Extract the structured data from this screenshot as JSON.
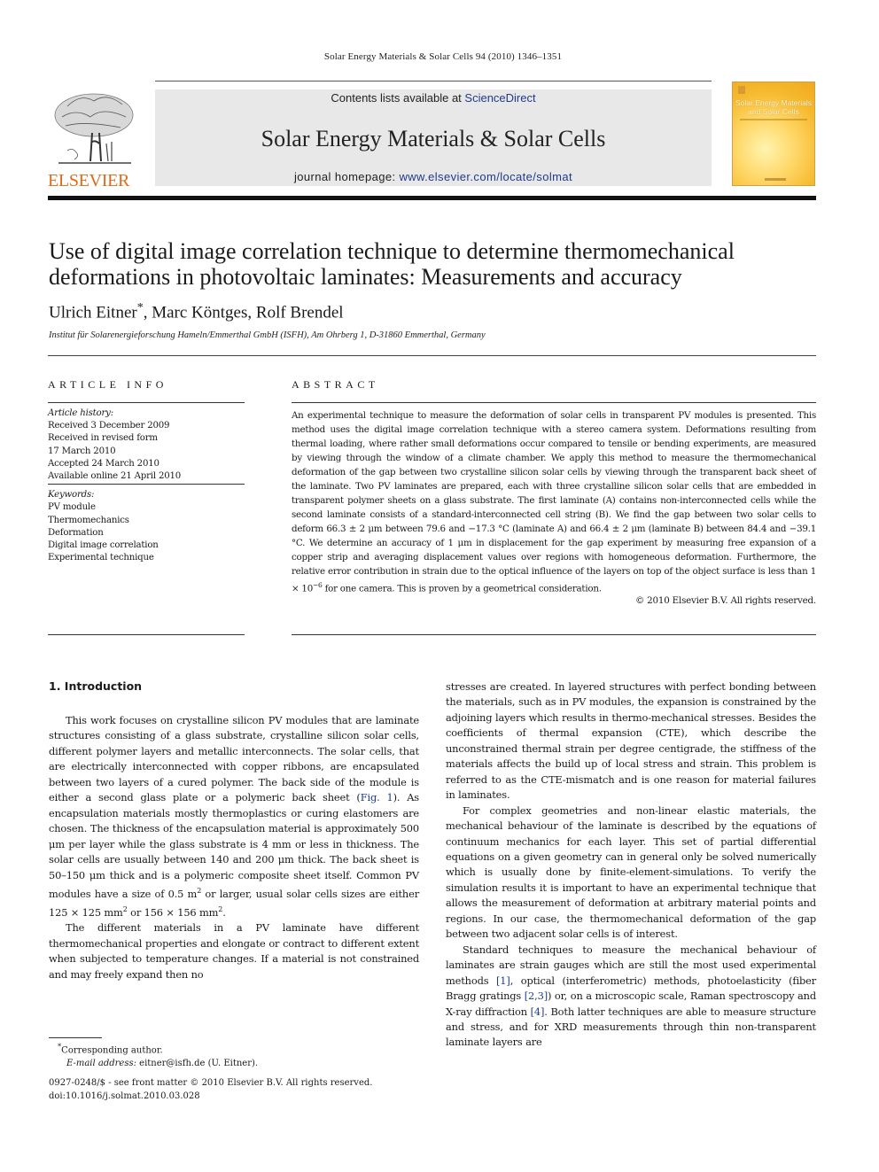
{
  "running_head": "Solar Energy Materials & Solar Cells 94 (2010) 1346–1351",
  "header": {
    "publisher_logo": "ELSEVIER",
    "contents_prefix": "Contents lists available at ",
    "contents_link": "ScienceDirect",
    "journal_name": "Solar Energy Materials & Solar Cells",
    "homepage_prefix": "journal homepage: ",
    "homepage_link": "www.elsevier.com/locate/solmat",
    "cover_title": "Solar Energy Materials and Solar Cells",
    "colors": {
      "publisher_orange": "#e06a1a",
      "link_blue": "#1f3b8c",
      "banner_gray": "#e8e8e8"
    }
  },
  "article": {
    "title": "Use of digital image correlation technique to determine thermomechanical deformations in photovoltaic laminates: Measurements and accuracy",
    "authors": [
      {
        "name": "Ulrich Eitner",
        "mark": "*"
      },
      {
        "name": "Marc Köntges",
        "mark": ""
      },
      {
        "name": "Rolf Brendel",
        "mark": ""
      }
    ],
    "affiliation": "Institut für Solarenergieforschung Hameln/Emmerthal GmbH (ISFH), Am Ohrberg 1, D-31860 Emmerthal, Germany"
  },
  "article_info": {
    "heading": "ARTICLE INFO",
    "history_label": "Article history:",
    "history": [
      "Received 3 December 2009",
      "Received in revised form",
      "17 March 2010",
      "Accepted 24 March 2010",
      "Available online 21 April 2010"
    ],
    "keywords_label": "Keywords:",
    "keywords": [
      "PV module",
      "Thermomechanics",
      "Deformation",
      "Digital image correlation",
      "Experimental technique"
    ]
  },
  "abstract": {
    "heading": "ABSTRACT",
    "text_1": "An experimental technique to measure the deformation of solar cells in transparent PV modules is presented. This method uses the digital image correlation technique with a stereo camera system. Deformations resulting from thermal loading, where rather small deformations occur compared to tensile or bending experiments, are measured by viewing through the window of a climate chamber. We apply this method to measure the thermomechanical deformation of the gap between two crystalline silicon solar cells by viewing through the transparent back sheet of the laminate. Two PV laminates are prepared, each with three crystalline silicon solar cells that are embedded in transparent polymer sheets on a glass substrate. The first laminate (A) contains non-interconnected cells while the second laminate consists of a standard-interconnected cell string (B). We find the gap between two solar cells to deform 66.3 ± 2 μm between 79.6 and −17.3 °C (laminate A) and 66.4 ± 2 μm (laminate B) between 84.4 and −39.1 °C. We determine an accuracy of 1 μm in displacement for the gap experiment by measuring free expansion of a copper strip and averaging displacement values over regions with homogeneous deformation. Furthermore, the relative error contribution in strain due to the optical influence of the layers on top of the object surface is less than 1 × 10",
    "exponent": "−6",
    "text_2": " for one camera. This is proven by a geometrical consideration.",
    "copyright": "© 2010 Elsevier B.V. All rights reserved."
  },
  "body": {
    "section_heading": "1.  Introduction",
    "col1": {
      "p1_a": "This work focuses on crystalline silicon PV modules that are laminate structures consisting of a glass substrate, crystalline silicon solar cells, different polymer layers and metallic interconnects. The solar cells, that are electrically interconnected with copper ribbons, are encapsulated between two layers of a cured polymer. The back side of the module is either a second glass plate or a polymeric back sheet (",
      "p1_link": "Fig. 1",
      "p1_b": "). As encapsulation materials mostly thermoplastics or curing elastomers are chosen. The thickness of the encapsulation material is approximately 500 μm per layer while the glass substrate is 4 mm or less in thickness. The solar cells are usually between 140 and 200 μm thick. The back sheet is 50–150 μm thick and is a polymeric composite sheet itself. Common PV modules have a size of 0.5 m",
      "p1_sup1": "2",
      "p1_c": " or larger, usual solar cells sizes are either 125 × 125 mm",
      "p1_sup2": "2",
      "p1_d": " or 156 × 156 mm",
      "p1_sup3": "2",
      "p1_e": ".",
      "p2": "The different materials in a PV laminate have different thermomechanical properties and elongate or contract to different extent when subjected to temperature changes. If a material is not constrained and may freely expand then no"
    },
    "col2": {
      "p1": "stresses are created. In layered structures with perfect bonding between the materials, such as in PV modules, the expansion is constrained by the adjoining layers which results in thermo-mechanical stresses. Besides the coefficients of thermal expansion (CTE), which describe the unconstrained thermal strain per degree centigrade, the stiffness of the materials affects the build up of local stress and strain. This problem is referred to as the CTE-mismatch and is one reason for material failures in laminates.",
      "p2": "For complex geometries and non-linear elastic materials, the mechanical behaviour of the laminate is described by the equations of continuum mechanics for each layer. This set of partial differential equations on a given geometry can in general only be solved numerically which is usually done by finite-element-simulations. To verify the simulation results it is important to have an experimental technique that allows the measurement of deformation at arbitrary material points and regions. In our case, the thermomechanical deformation of the gap between two adjacent solar cells is of interest.",
      "p3_a": "Standard techniques to measure the mechanical behaviour of laminates are strain gauges which are still the most used experimental methods ",
      "ref1": "[1]",
      "p3_b": ", optical (interferometric) methods, photoelasticity (fiber Bragg gratings ",
      "ref2": "[2,3]",
      "p3_c": ") or, on a microscopic scale, Raman spectroscopy and X-ray diffraction ",
      "ref3": "[4]",
      "p3_d": ". Both latter techniques are able to measure structure and stress, and for XRD measurements through thin non-transparent laminate layers are"
    }
  },
  "footnotes": {
    "mark": "*",
    "corresponding": "Corresponding author.",
    "email_label": "E-mail address:",
    "email": " eitner@isfh.de (U. Eitner)."
  },
  "front_matter": {
    "issn_line": "0927-0248/$ - see front matter © 2010 Elsevier B.V. All rights reserved.",
    "doi": "doi:10.1016/j.solmat.2010.03.028"
  }
}
